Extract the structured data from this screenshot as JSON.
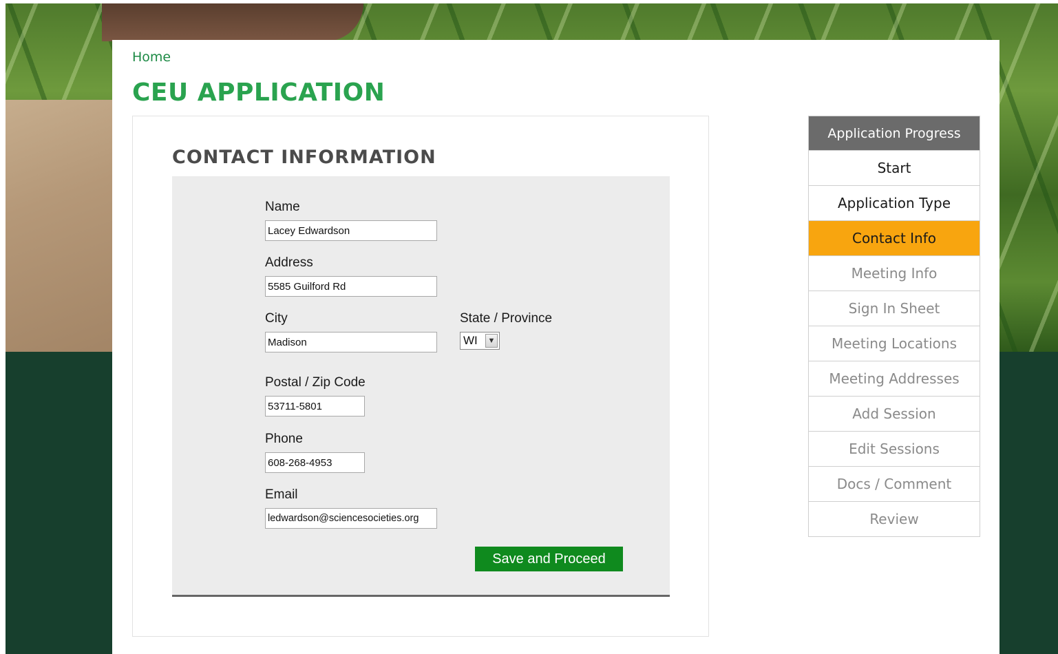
{
  "breadcrumb": {
    "home": "Home"
  },
  "page_title": "CEU APPLICATION",
  "form": {
    "section_title": "CONTACT INFORMATION",
    "fields": {
      "name": {
        "label": "Name",
        "value": "Lacey Edwardson"
      },
      "address": {
        "label": "Address",
        "value": "5585 Guilford Rd"
      },
      "city": {
        "label": "City",
        "value": "Madison"
      },
      "state": {
        "label": "State / Province",
        "value": "WI"
      },
      "zip": {
        "label": "Postal / Zip Code",
        "value": "53711-5801"
      },
      "phone": {
        "label": "Phone",
        "value": "608-268-4953"
      },
      "email": {
        "label": "Email",
        "value": "ledwardson@sciencesocieties.org"
      }
    },
    "save_label": "Save and Proceed"
  },
  "progress": {
    "header": "Application Progress",
    "items": [
      {
        "label": "Start",
        "state": "done"
      },
      {
        "label": "Application Type",
        "state": "done"
      },
      {
        "label": "Contact Info",
        "state": "active"
      },
      {
        "label": "Meeting Info",
        "state": "pending"
      },
      {
        "label": "Sign In Sheet",
        "state": "pending"
      },
      {
        "label": "Meeting Locations",
        "state": "pending"
      },
      {
        "label": "Meeting Addresses",
        "state": "pending"
      },
      {
        "label": "Add Session",
        "state": "pending"
      },
      {
        "label": "Edit Sessions",
        "state": "pending"
      },
      {
        "label": "Docs / Comment",
        "state": "pending"
      },
      {
        "label": "Review",
        "state": "pending"
      }
    ],
    "active_color": "#f8a50f"
  },
  "colors": {
    "title_green": "#2aa34f",
    "button_green": "#0f8a1e",
    "footer_green": "#173f2d"
  }
}
